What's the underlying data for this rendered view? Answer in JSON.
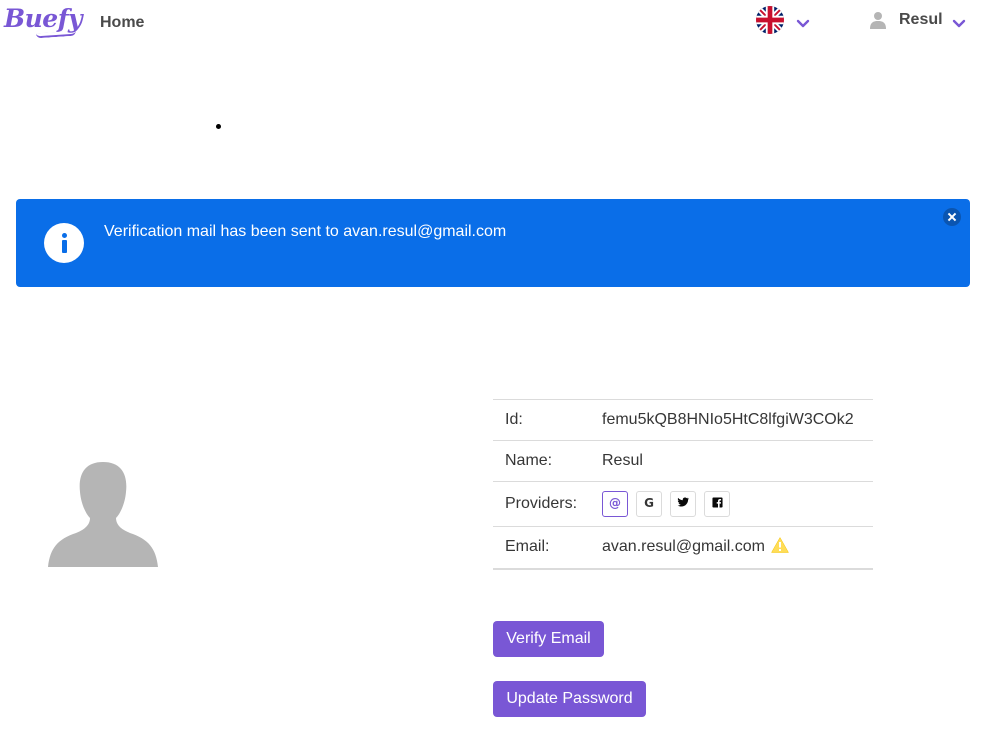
{
  "navbar": {
    "brand": "Buefy",
    "home_label": "Home",
    "user_name": "Resul"
  },
  "notification": {
    "message": "Verification mail has been sent to avan.resul@gmail.com",
    "type": "info"
  },
  "profile": {
    "rows": [
      {
        "label": "Id:",
        "value": "femu5kQB8HNIo5HtC8lfgiW3COk2"
      },
      {
        "label": "Name:",
        "value": "Resul"
      },
      {
        "label": "Providers:",
        "value": ""
      },
      {
        "label": "Email:",
        "value": "avan.resul@gmail.com"
      }
    ],
    "providers": [
      {
        "icon": "email-at-icon",
        "glyph": "@",
        "active": true
      },
      {
        "icon": "google-icon",
        "glyph": "G",
        "active": false
      },
      {
        "icon": "twitter-icon",
        "glyph": "t",
        "active": false
      },
      {
        "icon": "facebook-icon",
        "glyph": "f",
        "active": false
      }
    ],
    "email_status_icon": "warning-icon"
  },
  "actions": {
    "verify_label": "Verify Email",
    "update_password_label": "Update Password"
  },
  "colors": {
    "primary": "#7957d5",
    "info": "#0a6ee8",
    "warning": "#ffdd57"
  }
}
